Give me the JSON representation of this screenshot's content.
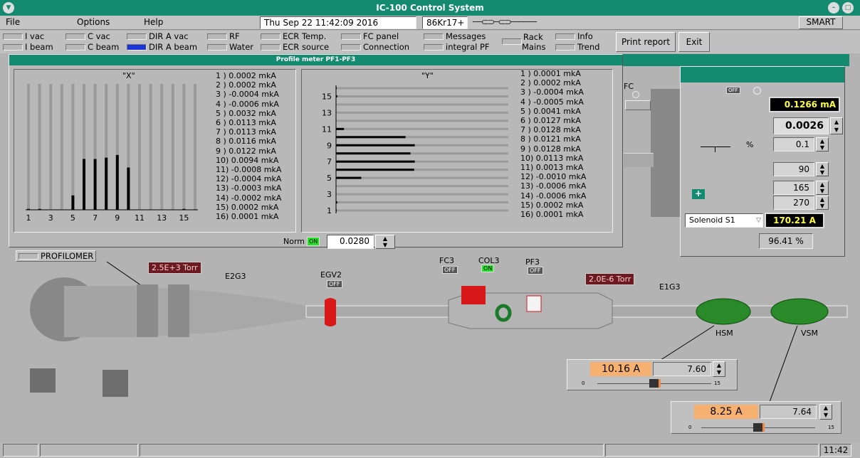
{
  "window": {
    "title": "IC-100 Control System"
  },
  "menu": [
    "File",
    "Options",
    "Help"
  ],
  "datetime": "Thu Sep 22 11:42:09 2016",
  "ion": "86Kr17+",
  "smart": "SMART",
  "toggles_row1": [
    "I vac",
    "C vac",
    "DIR A vac",
    "RF",
    "ECR Temp.",
    "FC panel",
    "Messages"
  ],
  "toggles_row2": [
    "I beam",
    "C beam",
    "DIR A beam",
    "Water",
    "ECR source",
    "Connection",
    "integral PF"
  ],
  "rack": [
    "Rack",
    "Mains"
  ],
  "info": [
    "Info",
    "Trend"
  ],
  "print_label": "Print report",
  "exit_label": "Exit",
  "profile": {
    "title": "Profile meter PF1-PF3",
    "x_title": "\"X\"",
    "y_title": "\"Y\"",
    "x_readings": [
      "1 ) 0.0002 mkA",
      "2 ) 0.0002 mkA",
      "3 ) -0.0004 mkA",
      "4 ) -0.0006 mkA",
      "5 ) 0.0032 mkA",
      "6 ) 0.0113 mkA",
      "7 ) 0.0113 mkA",
      "8 ) 0.0116 mkA",
      "9 ) 0.0122 mkA",
      "10) 0.0094 mkA",
      "11) -0.0008 mkA",
      "12) -0.0004 mkA",
      "13) -0.0003 mkA",
      "14) -0.0002 mkA",
      "15) 0.0002 mkA",
      "16) 0.0001 mkA"
    ],
    "y_readings": [
      "1 ) 0.0001 mkA",
      "2 ) 0.0002 mkA",
      "3 ) -0.0004 mkA",
      "4 ) -0.0005 mkA",
      "5 ) 0.0041 mkA",
      "6 ) 0.0127 mkA",
      "7 ) 0.0128 mkA",
      "8 ) 0.0121 mkA",
      "9 ) 0.0128 mkA",
      "10) 0.0113 mkA",
      "11) 0.0013 mkA",
      "12) -0.0010 mkA",
      "13) -0.0006 mkA",
      "14) -0.0006 mkA",
      "15) 0.0002 mkA",
      "16) 0.0001 mkA"
    ],
    "norm_label": "Norm",
    "norm_state": "ON",
    "norm_value": "0.0280"
  },
  "chart_data": [
    {
      "type": "bar",
      "title": "\"X\"",
      "categories": [
        "1",
        "2",
        "3",
        "4",
        "5",
        "6",
        "7",
        "8",
        "9",
        "10",
        "11",
        "12",
        "13",
        "14",
        "15",
        "16"
      ],
      "x_ticks": [
        "1",
        "3",
        "5",
        "7",
        "9",
        "11",
        "13",
        "15"
      ],
      "values": [
        0.0002,
        0.0002,
        -0.0004,
        -0.0006,
        0.0032,
        0.0113,
        0.0113,
        0.0116,
        0.0122,
        0.0094,
        -0.0008,
        -0.0004,
        -0.0003,
        -0.0002,
        0.0002,
        0.0001
      ],
      "ylim": [
        0,
        0.028
      ]
    },
    {
      "type": "bar",
      "orientation": "horizontal",
      "title": "\"Y\"",
      "categories": [
        "1",
        "2",
        "3",
        "4",
        "5",
        "6",
        "7",
        "8",
        "9",
        "10",
        "11",
        "12",
        "13",
        "14",
        "15",
        "16"
      ],
      "y_ticks": [
        "1",
        "3",
        "5",
        "7",
        "9",
        "11",
        "13",
        "15"
      ],
      "values": [
        0.0001,
        0.0002,
        -0.0004,
        -0.0005,
        0.0041,
        0.0127,
        0.0128,
        0.0121,
        0.0128,
        0.0113,
        0.0013,
        -0.001,
        -0.0006,
        -0.0006,
        0.0002,
        0.0001
      ],
      "xlim": [
        0,
        0.028
      ]
    }
  ],
  "fc_label": "FC",
  "right_panel": {
    "state": "OFF",
    "current": "0.1266 mA",
    "value1": "0.0026",
    "pct_unit": "%",
    "pct_value": "0.1",
    "a1": "90",
    "a2": "165",
    "a3": "270",
    "plus": "+",
    "solenoid_select": "Solenoid S1",
    "solenoid_current": "170.21 A",
    "percent": "96.41 %"
  },
  "beamline": {
    "profilomer": "PROFILOMER",
    "vac1": "2.5E+3 Torr",
    "e2g3": "E2G3",
    "egv2": "EGV2",
    "egv2_state": "OFF",
    "fc3": "FC3",
    "fc3_state": "OFF",
    "col3": "COL3",
    "col3_state": "ON",
    "pf3": "PF3",
    "pf3_state": "OFF",
    "vac2": "2.0E-6 Torr",
    "e1g3": "E1G3",
    "hsm": "HSM",
    "vsm": "VSM"
  },
  "hsm_ctrl": {
    "actual": "10.16 A",
    "set": "7.60",
    "min": "0",
    "max": "15",
    "level": 7.6
  },
  "vsm_ctrl": {
    "actual": "8.25 A",
    "set": "7.64",
    "min": "0",
    "max": "15",
    "level": 7.64
  },
  "status": {
    "time": "11:42"
  }
}
